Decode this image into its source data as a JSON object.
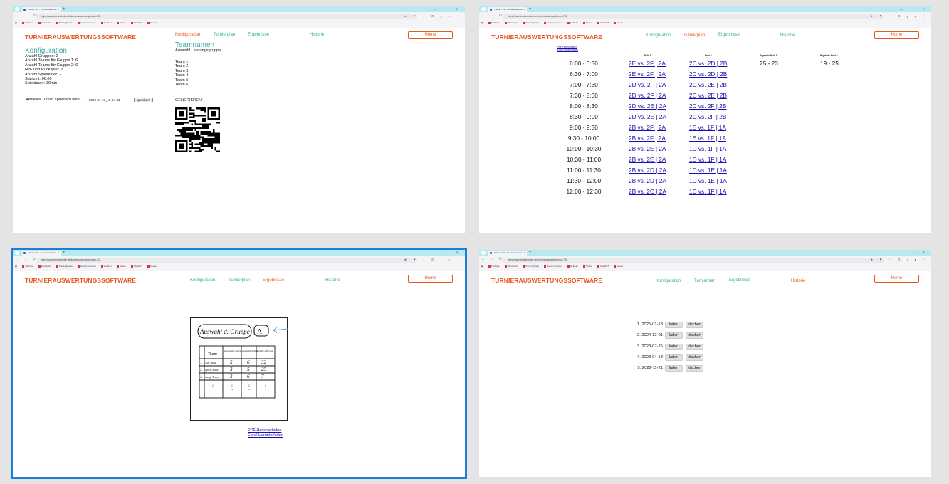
{
  "browser": {
    "tab_title": "Turnier 731 - Turnierauswertu…",
    "url": "https://www.drunterdruber.de/turnierauswertung/turnier-731",
    "bookmarks": [
      "YouTube",
      "Wunderlist",
      "TrainingPeaks",
      "Garmin Connect",
      "Getheim",
      "Strava",
      "ChatGPT",
      "Neuen"
    ]
  },
  "brand": "TURNIERAUSWERTUNGSSOFTWARE",
  "nav": {
    "config": "Konfiguration",
    "plan": "Turnierplan",
    "results": "Ergebnisse",
    "history": "Historie",
    "home": "Home"
  },
  "config": {
    "heading": "Konfiguration",
    "lines": [
      "Anzahl Gruppen: 2",
      "Anzahl Teams für Gruppe 1: 6",
      "Anzahl Teams für Gruppe 2: 6",
      "Hin- und Rückspiel: ja",
      "Anzahl Spielfelder: 2",
      "Startzeit: 06:00",
      "Spieldauer: 30min"
    ],
    "save_label": "Aktuelles Turnier speichern unter",
    "save_value": "2025-01-13_15-54-33",
    "save_button": "speichern"
  },
  "teamnames": {
    "heading": "Teamnamen",
    "select_label": "Auswahl Leistungsgruppe:",
    "teams": [
      "Team 1:",
      "Team 2:",
      "Team 3:",
      "Team 4:",
      "Team 5:",
      "Team 6:"
    ],
    "generate": "GENERIEREN!"
  },
  "plan": {
    "pdf_link": "PDF Herunterladen",
    "excel_link": "Excel Herunterladen",
    "col_field1": "Feld 1",
    "col_field2": "Feld 2",
    "col_result1": "Ergebnis Feld 1",
    "col_result2": "Ergebnis Feld 2",
    "rows": [
      {
        "time": "6:00 - 6:30",
        "f1": "2E vs. 2F | 2A",
        "f2": "2C vs. 2D | 2B",
        "r1": "25 - 23",
        "r2": "19 - 25"
      },
      {
        "time": "6:30 - 7:00",
        "f1": "2E vs. 2F | 2A",
        "f2": "2C vs. 2D | 2B",
        "r1": "",
        "r2": ""
      },
      {
        "time": "7:00 - 7:30",
        "f1": "2D vs. 2F | 2A",
        "f2": "2C vs. 2E | 2B",
        "r1": "",
        "r2": ""
      },
      {
        "time": "7:30 - 8:00",
        "f1": "2D vs. 2F | 2A",
        "f2": "2C vs. 2E | 2B",
        "r1": "",
        "r2": ""
      },
      {
        "time": "8:00 - 8:30",
        "f1": "2D vs. 2E | 2A",
        "f2": "2C vs. 2F | 2B",
        "r1": "",
        "r2": ""
      },
      {
        "time": "8:30 - 9:00",
        "f1": "2D vs. 2E | 2A",
        "f2": "2C vs. 2F | 2B",
        "r1": "",
        "r2": ""
      },
      {
        "time": "9:00 - 9:30",
        "f1": "2B vs. 2F | 2A",
        "f2": "1E vs. 1F | 1A",
        "r1": "",
        "r2": ""
      },
      {
        "time": "9:30 - 10:00",
        "f1": "2B vs. 2F | 2A",
        "f2": "1E vs. 1F | 1A",
        "r1": "",
        "r2": ""
      },
      {
        "time": "10:00 - 10:30",
        "f1": "2B vs. 2E | 2A",
        "f2": "1D vs. 1F | 1A",
        "r1": "",
        "r2": ""
      },
      {
        "time": "10:30 - 11:00",
        "f1": "2B vs. 2E | 2A",
        "f2": "1D vs. 1F | 1A",
        "r1": "",
        "r2": ""
      },
      {
        "time": "11:00 - 11:30",
        "f1": "2B vs. 2D | 2A",
        "f2": "1D vs. 1E | 1A",
        "r1": "",
        "r2": ""
      },
      {
        "time": "11:30 - 12:00",
        "f1": "2B vs. 2D | 2A",
        "f2": "1D vs. 1E | 1A",
        "r1": "",
        "r2": ""
      },
      {
        "time": "12:00 - 12:30",
        "f1": "2B vs. 2C | 2A",
        "f2": "1C vs. 1F | 1A",
        "r1": "",
        "r2": ""
      }
    ]
  },
  "results": {
    "sketch_title": "Auswahl d. Gruppe",
    "sketch_group": "A",
    "sketch_headers": [
      "Team",
      "gewonnene Spiele",
      "gespielte Spiele",
      "Punkte-differenz"
    ],
    "sketch_rows": [
      {
        "rank": "1.",
        "team": "Alle Hase",
        "won": "5",
        "played": "6",
        "diff": "32"
      },
      {
        "rank": "2.",
        "team": "Pfeile Hase",
        "won": "3",
        "played": "5",
        "diff": "25"
      },
      {
        "rank": "3.",
        "team": "Jungs Team",
        "won": "3",
        "played": "6",
        "diff": "7"
      }
    ],
    "pdf_link": "PDF Herunterladen",
    "excel_link": "Excel Herunterladen"
  },
  "history": {
    "load": "laden",
    "delete": "löschen",
    "entries": [
      "1. 2025-01-13",
      "2. 2024-12-01",
      "3. 2023-07-25",
      "4. 2023-04-13",
      "5. 2022-11-21"
    ]
  },
  "colors": {
    "brand": "#e8581e",
    "accent": "#3aab9c",
    "link": "#1a0dab",
    "selection": "#1a7fd8"
  }
}
